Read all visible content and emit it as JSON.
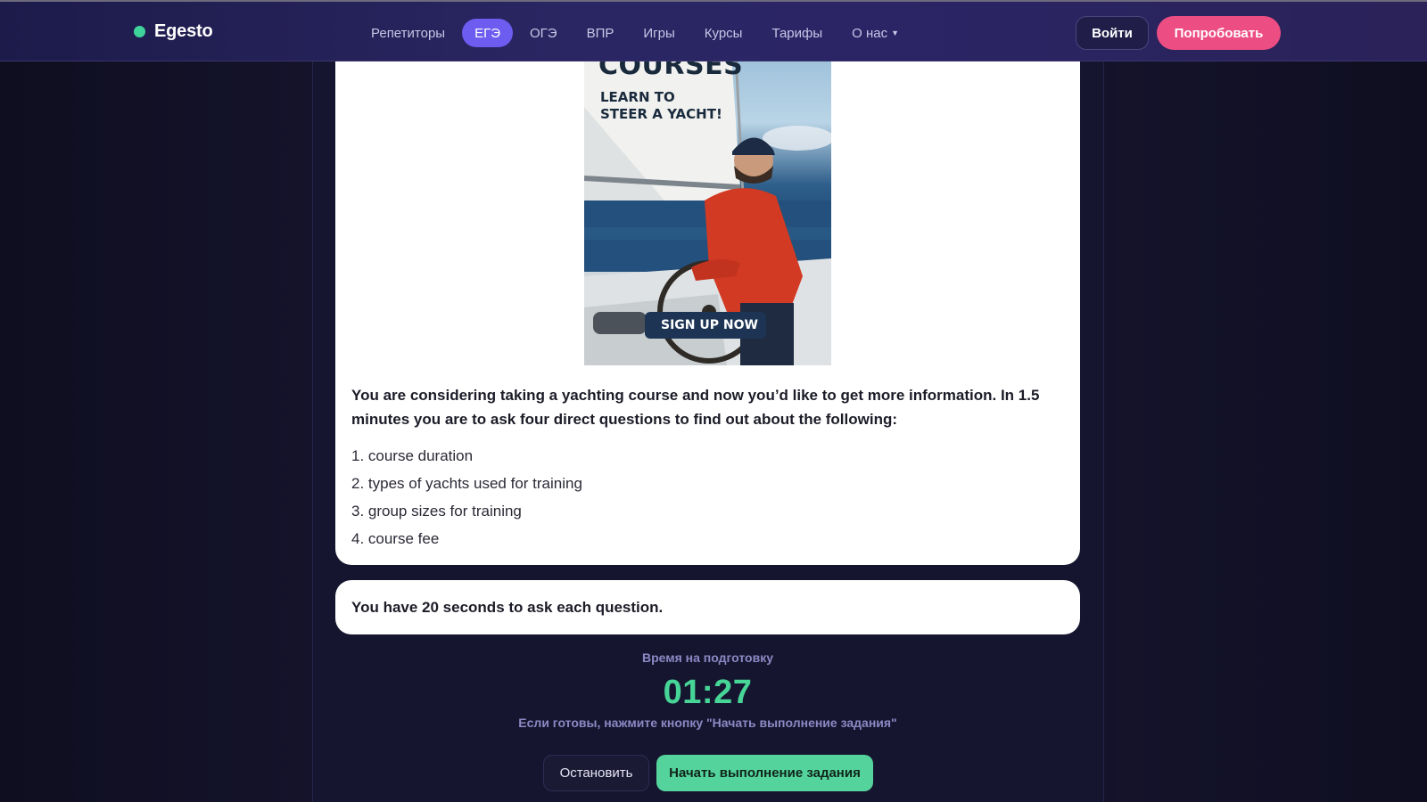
{
  "brand": {
    "name": "Egesto",
    "accent": "#3fd39b"
  },
  "nav": {
    "items": [
      {
        "label": "Репетиторы",
        "active": false
      },
      {
        "label": "ЕГЭ",
        "active": true
      },
      {
        "label": "ОГЭ",
        "active": false
      },
      {
        "label": "ВПР",
        "active": false
      },
      {
        "label": "Игры",
        "active": false
      },
      {
        "label": "Курсы",
        "active": false
      },
      {
        "label": "Тарифы",
        "active": false
      },
      {
        "label": "О нас",
        "active": false,
        "has_dropdown": true
      }
    ],
    "login_label": "Войти",
    "try_label": "Попробовать",
    "dropdown_icon": "caret-down-icon"
  },
  "poster": {
    "title": "COURSES",
    "subtitle": "LEARN TO STEER A YACHT!",
    "cta": "SIGN UP NOW"
  },
  "task": {
    "question": "You are considering taking a yachting course and now you’d like to get more information. In 1.5 minutes you are to ask four direct questions to find out about the following:",
    "items": [
      "1. course duration",
      "2. types of yachts used for training",
      "3. group sizes for training",
      "4. course fee"
    ],
    "note": "You have 20 seconds to ask each question."
  },
  "prep": {
    "label": "Время на подготовку",
    "timer": "01:27",
    "hint": "Если готовы, нажмите кнопку \"Начать выполнение задания\""
  },
  "actions": {
    "stop_label": "Остановить",
    "start_label": "Начать выполнение задания"
  },
  "colors": {
    "nav_active": "#6c5cf0",
    "try_button": "#ec4d82",
    "timer": "#46d497",
    "start_button": "#54d39c"
  }
}
